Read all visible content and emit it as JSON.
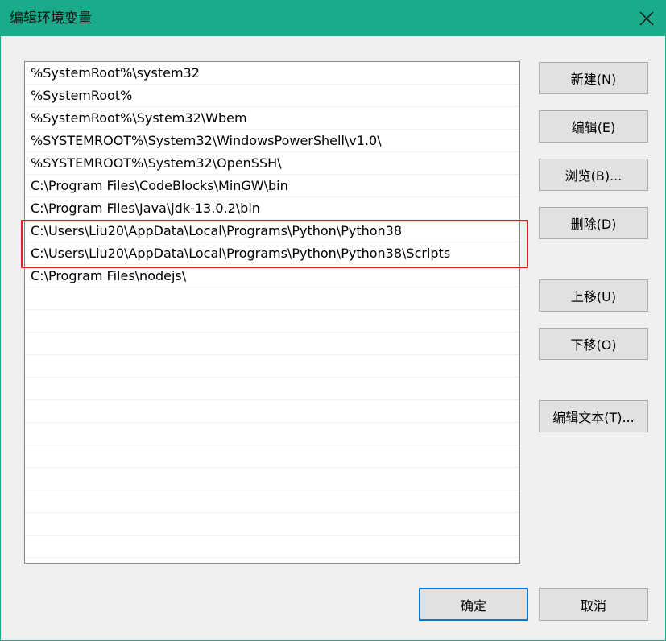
{
  "window": {
    "title": "编辑环境变量",
    "close_icon": "close-icon",
    "accent_color": "#1aab8a"
  },
  "list": {
    "items": [
      "%SystemRoot%\\system32",
      "%SystemRoot%",
      "%SystemRoot%\\System32\\Wbem",
      "%SYSTEMROOT%\\System32\\WindowsPowerShell\\v1.0\\",
      "%SYSTEMROOT%\\System32\\OpenSSH\\",
      "C:\\Program Files\\CodeBlocks\\MinGW\\bin",
      "C:\\Program Files\\Java\\jdk-13.0.2\\bin",
      "C:\\Users\\Liu20\\AppData\\Local\\Programs\\Python\\Python38",
      "C:\\Users\\Liu20\\AppData\\Local\\Programs\\Python\\Python38\\Scripts",
      "C:\\Program Files\\nodejs\\"
    ],
    "highlight_color": "#e02020"
  },
  "buttons": {
    "new": "新建(N)",
    "edit": "编辑(E)",
    "browse": "浏览(B)...",
    "delete": "删除(D)",
    "move_up": "上移(U)",
    "move_down": "下移(O)",
    "edit_text": "编辑文本(T)...",
    "ok": "确定",
    "cancel": "取消"
  }
}
